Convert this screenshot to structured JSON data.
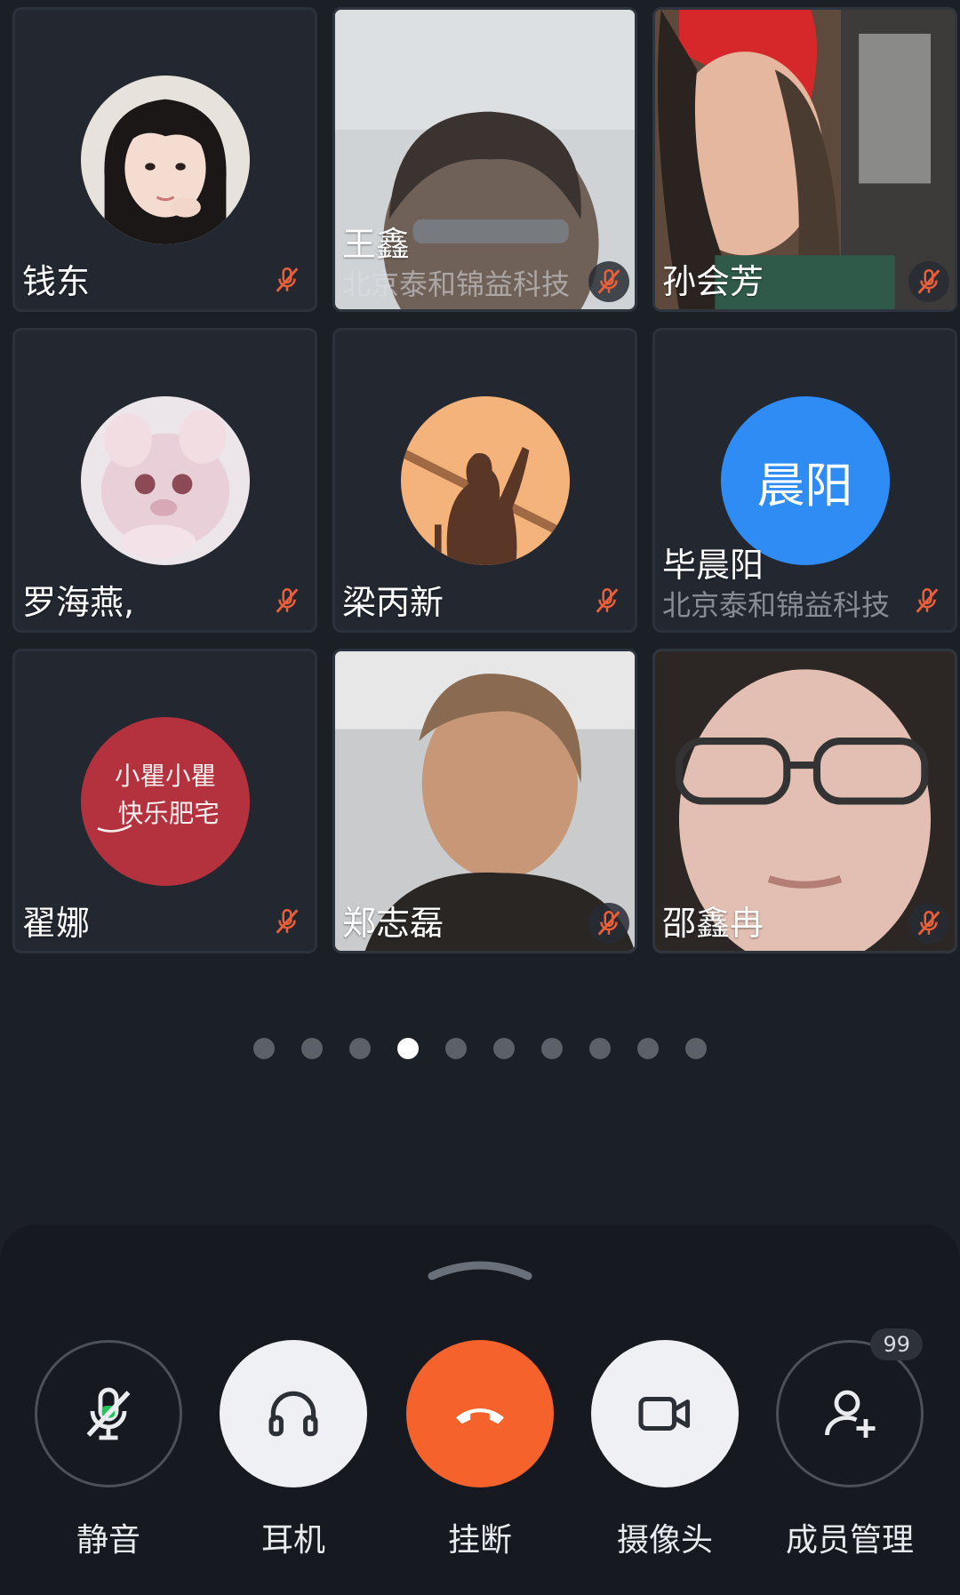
{
  "participants": [
    {
      "name": "钱东",
      "kind": "avatar",
      "muted": true
    },
    {
      "name": "王鑫",
      "org": "北京泰和锦益科技",
      "kind": "video",
      "muted": true
    },
    {
      "name": "孙会芳",
      "kind": "video",
      "muted": true
    },
    {
      "name": "罗海燕,",
      "kind": "avatar",
      "muted": true
    },
    {
      "name": "梁丙新",
      "kind": "avatar",
      "muted": true
    },
    {
      "name": "毕晨阳",
      "org": "北京泰和锦益科技",
      "kind": "text-avatar",
      "avatar_text": "晨阳",
      "muted": true
    },
    {
      "name": "翟娜",
      "kind": "avatar",
      "muted": true,
      "avatar_text": "小瞿小瞿 快乐肥宅"
    },
    {
      "name": "郑志磊",
      "kind": "video",
      "muted": true
    },
    {
      "name": "邵鑫冉",
      "kind": "video",
      "muted": true
    }
  ],
  "pager": {
    "total": 10,
    "active_index": 3
  },
  "controls": {
    "mute": {
      "label": "静音",
      "icon": "mic-off-icon"
    },
    "headset": {
      "label": "耳机",
      "icon": "headphones-icon"
    },
    "hangup": {
      "label": "挂断",
      "icon": "phone-hangup-icon"
    },
    "camera": {
      "label": "摄像头",
      "icon": "video-camera-icon"
    },
    "members": {
      "label": "成员管理",
      "icon": "add-user-icon",
      "badge": "99"
    }
  },
  "colors": {
    "background": "#1b1f26",
    "tile": "#222730",
    "hangup": "#f5622b",
    "mic_off": "#e8603a",
    "text_avatar": "#2f8cf4"
  }
}
